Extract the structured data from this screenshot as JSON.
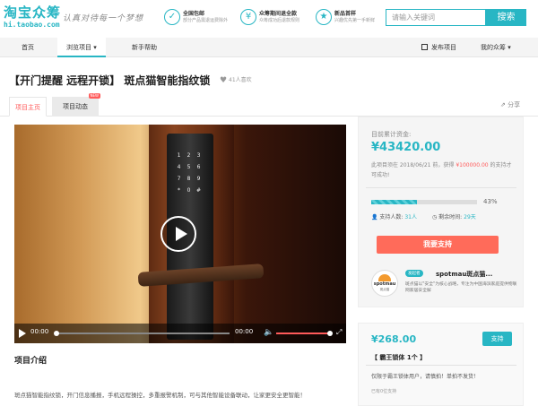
{
  "header": {
    "logo_main": "淘宝众筹",
    "logo_sub": "hi.taobao.com",
    "slogan": "认真对待每一个梦想",
    "features": [
      {
        "icon": "shield-check-icon",
        "title": "全国包邮",
        "desc": "部分产品需退运费除外"
      },
      {
        "icon": "refund-icon",
        "title": "众筹期间退全款",
        "desc": "众筹成功后退款规则"
      },
      {
        "icon": "new-goods-icon",
        "title": "新品首样",
        "desc": "兴趣优先第一手新鲜"
      }
    ],
    "search_placeholder": "请输入关键词",
    "search_button": "搜索"
  },
  "nav": {
    "items": [
      "首页",
      "浏览项目",
      "新手帮助"
    ],
    "publish": "发布项目",
    "my": "我的众筹"
  },
  "project": {
    "title": "【开门提醒 远程开锁】 斑点猫智能指纹锁",
    "likes": "41人喜欢"
  },
  "tabs": {
    "home": "项目主页",
    "news": "项目动态",
    "new_badge": "NEW",
    "share": "分享"
  },
  "video": {
    "time_current": "00:00",
    "time_total": "00:00",
    "keypad": [
      "1",
      "2",
      "3",
      "4",
      "5",
      "6",
      "7",
      "8",
      "9",
      "*",
      "0",
      "#"
    ],
    "progress": 0
  },
  "intro": {
    "title": "项目介绍",
    "text": "斑点猫智能指纹锁，开门信息播报，手机远程操控，多重报警机制，可与其他智能设备联动，让家更安全更智能！"
  },
  "funding": {
    "raised_label": "目前累计资金:",
    "raised_amount": "¥43420.00",
    "deadline_prefix": "此项目须在 2018/06/21 前，获得",
    "goal": "¥100000.00",
    "deadline_suffix": "的支持才可成功!",
    "percent_label": "43%",
    "percent": 0.43,
    "supporters_label": "支持人数:",
    "supporters_count": "31人",
    "remain_label": "剩余时间:",
    "remain_count": "29天",
    "support_button": "我要支持"
  },
  "sponsor": {
    "logo_text": "spotmau",
    "logo_cn": "斑点猫",
    "badge": "发起者",
    "name": "spotmau斑点猫...",
    "desc": "斑点猫以\"安全\"为核心战略，专注为中国海滨家庭提供物联网家居安全解"
  },
  "reward": {
    "price": "¥268.00",
    "button": "支持",
    "title": "【 霸王锁体 1个 】",
    "note": "仅限于霸王锁体用户，请慎拍！单拍不发货！",
    "count": "已有0位支持"
  },
  "colors": {
    "accent": "#28b6c4",
    "highlight": "#ff5a5a",
    "support_button": "#ff6b5a"
  }
}
